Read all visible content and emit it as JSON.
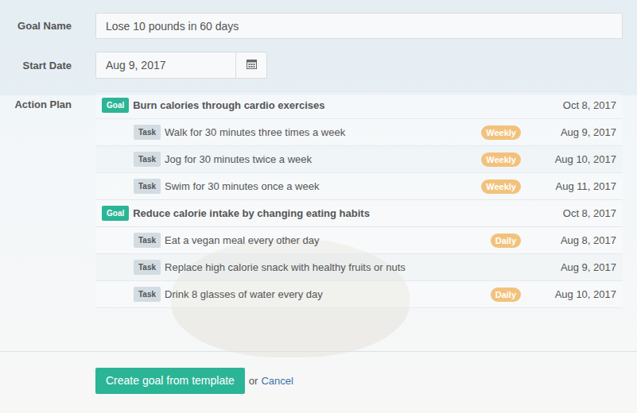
{
  "form": {
    "goal_name_label": "Goal Name",
    "goal_name": "Lose 10 pounds in 60 days",
    "start_date_label": "Start Date",
    "start_date": "Aug 9, 2017",
    "action_plan_label": "Action Plan"
  },
  "action_plan": [
    {
      "kind": "goal",
      "badge": "Goal",
      "title": "Burn calories through cardio exercises",
      "date": "Oct 8, 2017"
    },
    {
      "kind": "task",
      "badge": "Task",
      "title": "Walk for 30 minutes three times a week",
      "frequency": "Weekly",
      "date": "Aug 9, 2017"
    },
    {
      "kind": "task",
      "badge": "Task",
      "title": "Jog for 30 minutes twice a week",
      "frequency": "Weekly",
      "date": "Aug 10, 2017"
    },
    {
      "kind": "task",
      "badge": "Task",
      "title": "Swim for 30 minutes once a week",
      "frequency": "Weekly",
      "date": "Aug 11, 2017"
    },
    {
      "kind": "goal",
      "badge": "Goal",
      "title": "Reduce calorie intake by changing eating habits",
      "date": "Oct 8, 2017"
    },
    {
      "kind": "task",
      "badge": "Task",
      "title": "Eat a vegan meal every other day",
      "frequency": "Daily",
      "date": "Aug 8, 2017"
    },
    {
      "kind": "task",
      "badge": "Task",
      "title": "Replace high calorie snack with healthy fruits or nuts",
      "date": "Aug 9, 2017"
    },
    {
      "kind": "task",
      "badge": "Task",
      "title": "Drink 8 glasses of water every day",
      "frequency": "Daily",
      "date": "Aug 10, 2017"
    }
  ],
  "footer": {
    "submit": "Create goal from template",
    "or": "or",
    "cancel": "Cancel"
  }
}
